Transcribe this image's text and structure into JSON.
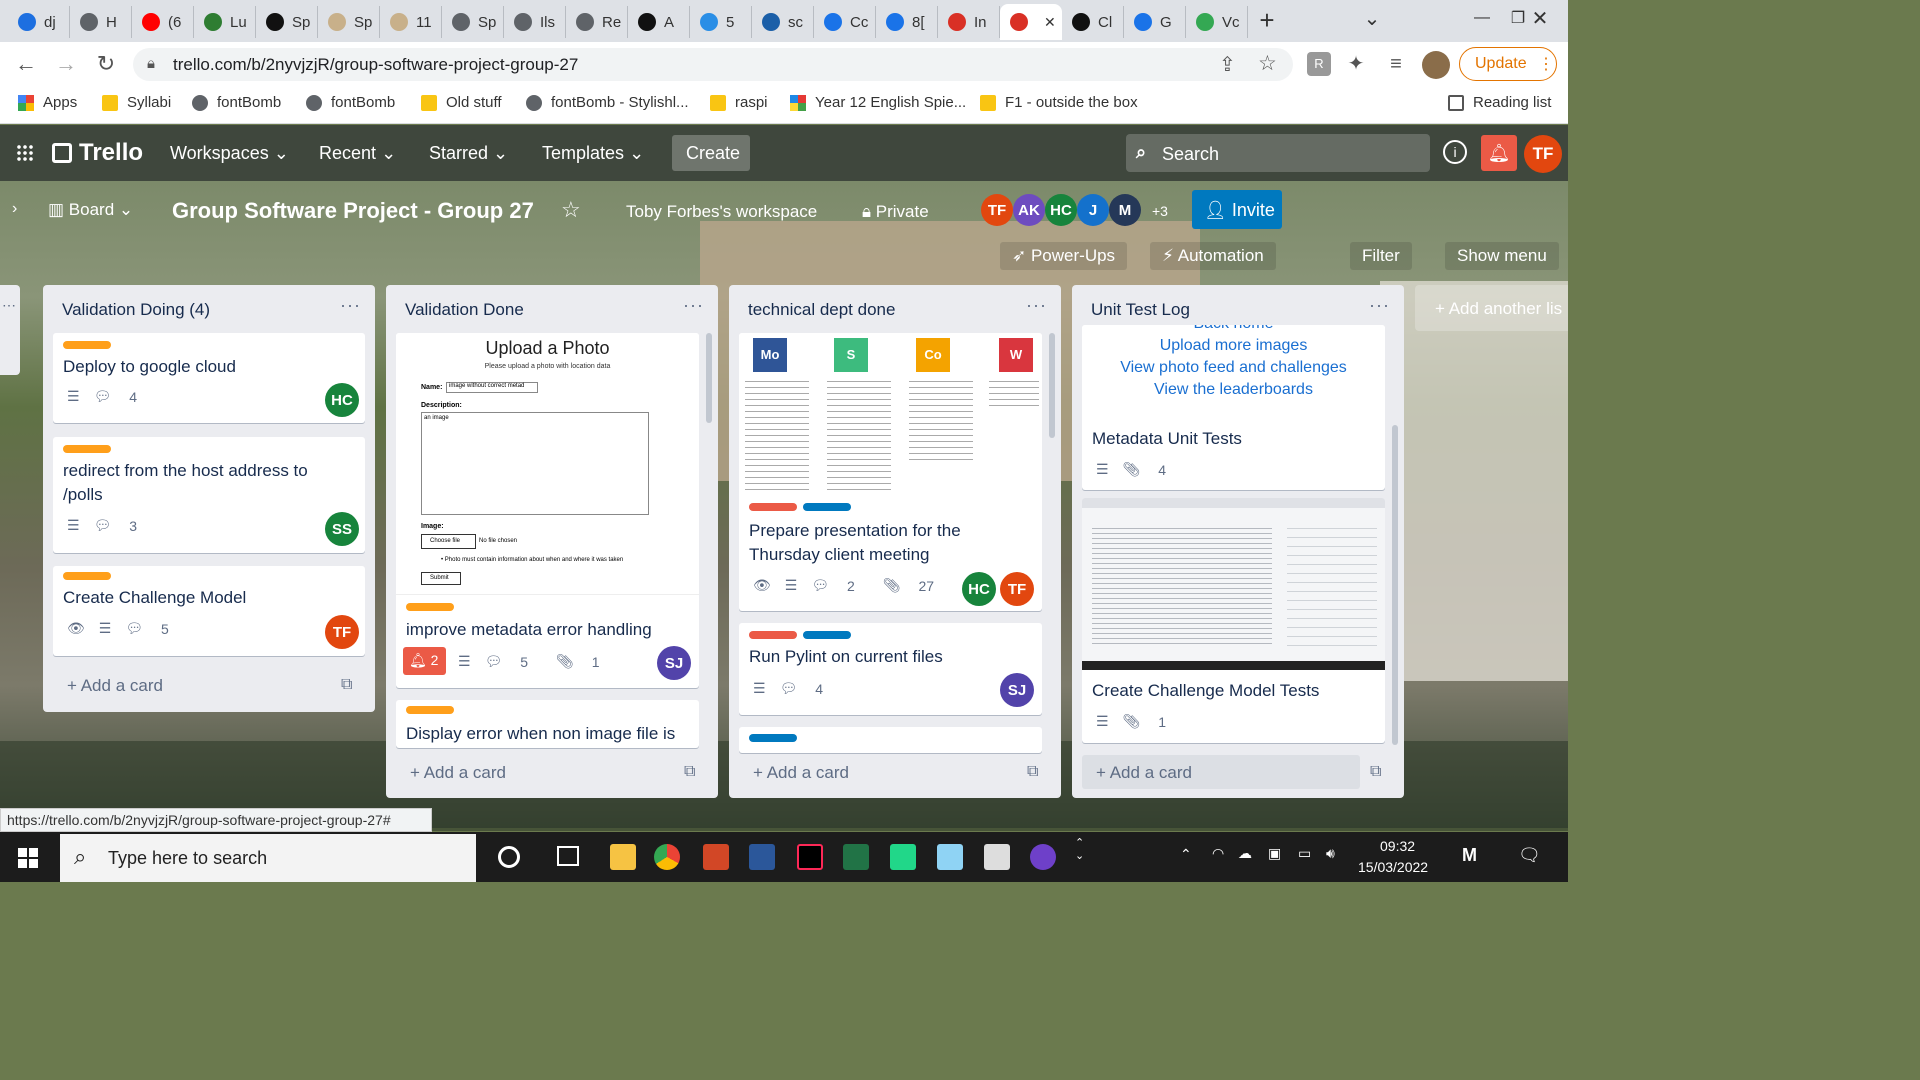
{
  "browser": {
    "tabs": [
      {
        "label": "dj",
        "icon": "jira-icon",
        "color": "#1d6fe0"
      },
      {
        "label": "H",
        "icon": "globe-icon",
        "color": "#5f6368"
      },
      {
        "label": "(6",
        "icon": "youtube-icon",
        "color": "#ff0000"
      },
      {
        "label": "Lu",
        "icon": "leaf-icon",
        "color": "#2e7d32"
      },
      {
        "label": "Sp",
        "icon": "b-icon",
        "color": "#111"
      },
      {
        "label": "Sp",
        "icon": "spotify-icon",
        "color": "#c8b08a"
      },
      {
        "label": "11",
        "icon": "spotify-icon",
        "color": "#c8b08a"
      },
      {
        "label": "Sp",
        "icon": "globe-icon",
        "color": "#5f6368"
      },
      {
        "label": "Ils",
        "icon": "globe-icon",
        "color": "#5f6368"
      },
      {
        "label": "Re",
        "icon": "globe-icon",
        "color": "#5f6368"
      },
      {
        "label": "A",
        "icon": "github-icon",
        "color": "#111"
      },
      {
        "label": "5",
        "icon": "check-icon",
        "color": "#2a8ee6"
      },
      {
        "label": "sc",
        "icon": "s-icon",
        "color": "#1b5fa8"
      },
      {
        "label": "Cc",
        "icon": "c-icon",
        "color": "#1a73e8"
      },
      {
        "label": "8[",
        "icon": "c-icon",
        "color": "#1a73e8"
      },
      {
        "label": "In",
        "icon": "gmail-icon",
        "color": "#d93025"
      },
      {
        "label": "",
        "icon": "trello-icon",
        "color": "#d93025",
        "active": true
      },
      {
        "label": "Cl",
        "icon": "github-icon",
        "color": "#111"
      },
      {
        "label": "G",
        "icon": "calendar-icon",
        "color": "#1a73e8"
      },
      {
        "label": "Vc",
        "icon": "maps-icon",
        "color": "#34a853"
      }
    ],
    "url": "trello.com/b/2nyvjzjR/group-software-project-group-27",
    "update_label": "Update",
    "bookmarks": [
      {
        "label": "Apps",
        "icon": "apps-icon"
      },
      {
        "label": "Syllabi",
        "icon": "folder-icon"
      },
      {
        "label": "fontBomb",
        "icon": "globe-icon"
      },
      {
        "label": "fontBomb",
        "icon": "globe-icon"
      },
      {
        "label": "Old stuff",
        "icon": "folder-icon"
      },
      {
        "label": "fontBomb - Stylishl...",
        "icon": "globe-icon"
      },
      {
        "label": "raspi",
        "icon": "folder-icon"
      },
      {
        "label": "Year 12 English Spie...",
        "icon": "pinwheel-icon"
      },
      {
        "label": "F1 - outside the box",
        "icon": "folder-icon"
      }
    ],
    "reading_list": "Reading list",
    "status_url": "https://trello.com/b/2nyvjzjR/group-software-project-group-27#"
  },
  "trello": {
    "logo": "Trello",
    "nav": [
      "Workspaces",
      "Recent",
      "Starred",
      "Templates"
    ],
    "create": "Create",
    "search_placeholder": "Search",
    "user_initials": "TF",
    "board": {
      "view": "Board",
      "title": "Group Software Project - Group 27",
      "workspace": "Toby Forbes's workspace",
      "visibility": "Private",
      "members": [
        {
          "initials": "TF",
          "color": "#e2470f"
        },
        {
          "initials": "AK",
          "color": "#6e4cbf"
        },
        {
          "initials": "HC",
          "color": "#17843c"
        },
        {
          "initials": "J",
          "color": "#1471cc"
        },
        {
          "initials": "M",
          "color": "#253858"
        }
      ],
      "member_count_extra": "+3",
      "invite": "Invite",
      "powerups": "Power-Ups",
      "automation": "Automation",
      "filter": "Filter",
      "show_menu": "Show menu",
      "add_list": "Add another lis"
    },
    "lists": [
      {
        "title": "Validation Doing (4)",
        "add_card": "Add a card",
        "cards": [
          {
            "title": "Deploy to google cloud",
            "comments": "4",
            "member": "HC"
          },
          {
            "title": "redirect from the host address to /polls",
            "comments": "3",
            "member": "SS"
          },
          {
            "title": "Create Challenge Model",
            "comments": "5",
            "member": "TF"
          }
        ]
      },
      {
        "title": "Validation Done",
        "add_card": "Add a card",
        "cards": [
          {
            "cover": {
              "heading": "Upload a Photo",
              "sub": "Please upload a photo with location data",
              "name_label": "Name:",
              "name_value": "image without correct metad",
              "desc_label": "Description:",
              "desc_value": "an image",
              "image_label": "Image:",
              "choose_file": "Choose file",
              "no_file": "No file chosen",
              "note": "Photo must contain information about when and where it was taken",
              "submit": "Submit"
            },
            "title": "improve metadata error handling",
            "notifications": "2",
            "comments": "5",
            "attachments": "1",
            "member": "SJ"
          },
          {
            "title": "Display error when non image file is"
          }
        ]
      },
      {
        "title": "technical dept done",
        "add_card": "Add a card",
        "cards": [
          {
            "cover": {
              "columns": [
                {
                  "tag": "Mo",
                  "color": "#2f5597"
                },
                {
                  "tag": "S",
                  "color": "#3dbb7e"
                },
                {
                  "tag": "Co",
                  "color": "#f4a300"
                },
                {
                  "tag": "W",
                  "color": "#d9363e"
                }
              ]
            },
            "title": "Prepare presentation for the Thursday client meeting",
            "comments": "2",
            "attachments": "27",
            "members": [
              "HC",
              "TF"
            ]
          },
          {
            "title": "Run Pylint on current files",
            "comments": "4",
            "member": "SJ"
          }
        ]
      },
      {
        "title": "Unit Test Log",
        "add_card": "Add a card",
        "cards": [
          {
            "cover_links": [
              "Back home",
              "Upload more images",
              "View photo feed and challenges",
              "View the leaderboards"
            ],
            "title": "Metadata Unit Tests",
            "attachments": "4"
          },
          {
            "title": "Create Challenge Model Tests",
            "attachments": "1"
          }
        ]
      }
    ]
  },
  "taskbar": {
    "search_placeholder": "Type here to search",
    "time": "09:32",
    "date": "15/03/2022"
  }
}
